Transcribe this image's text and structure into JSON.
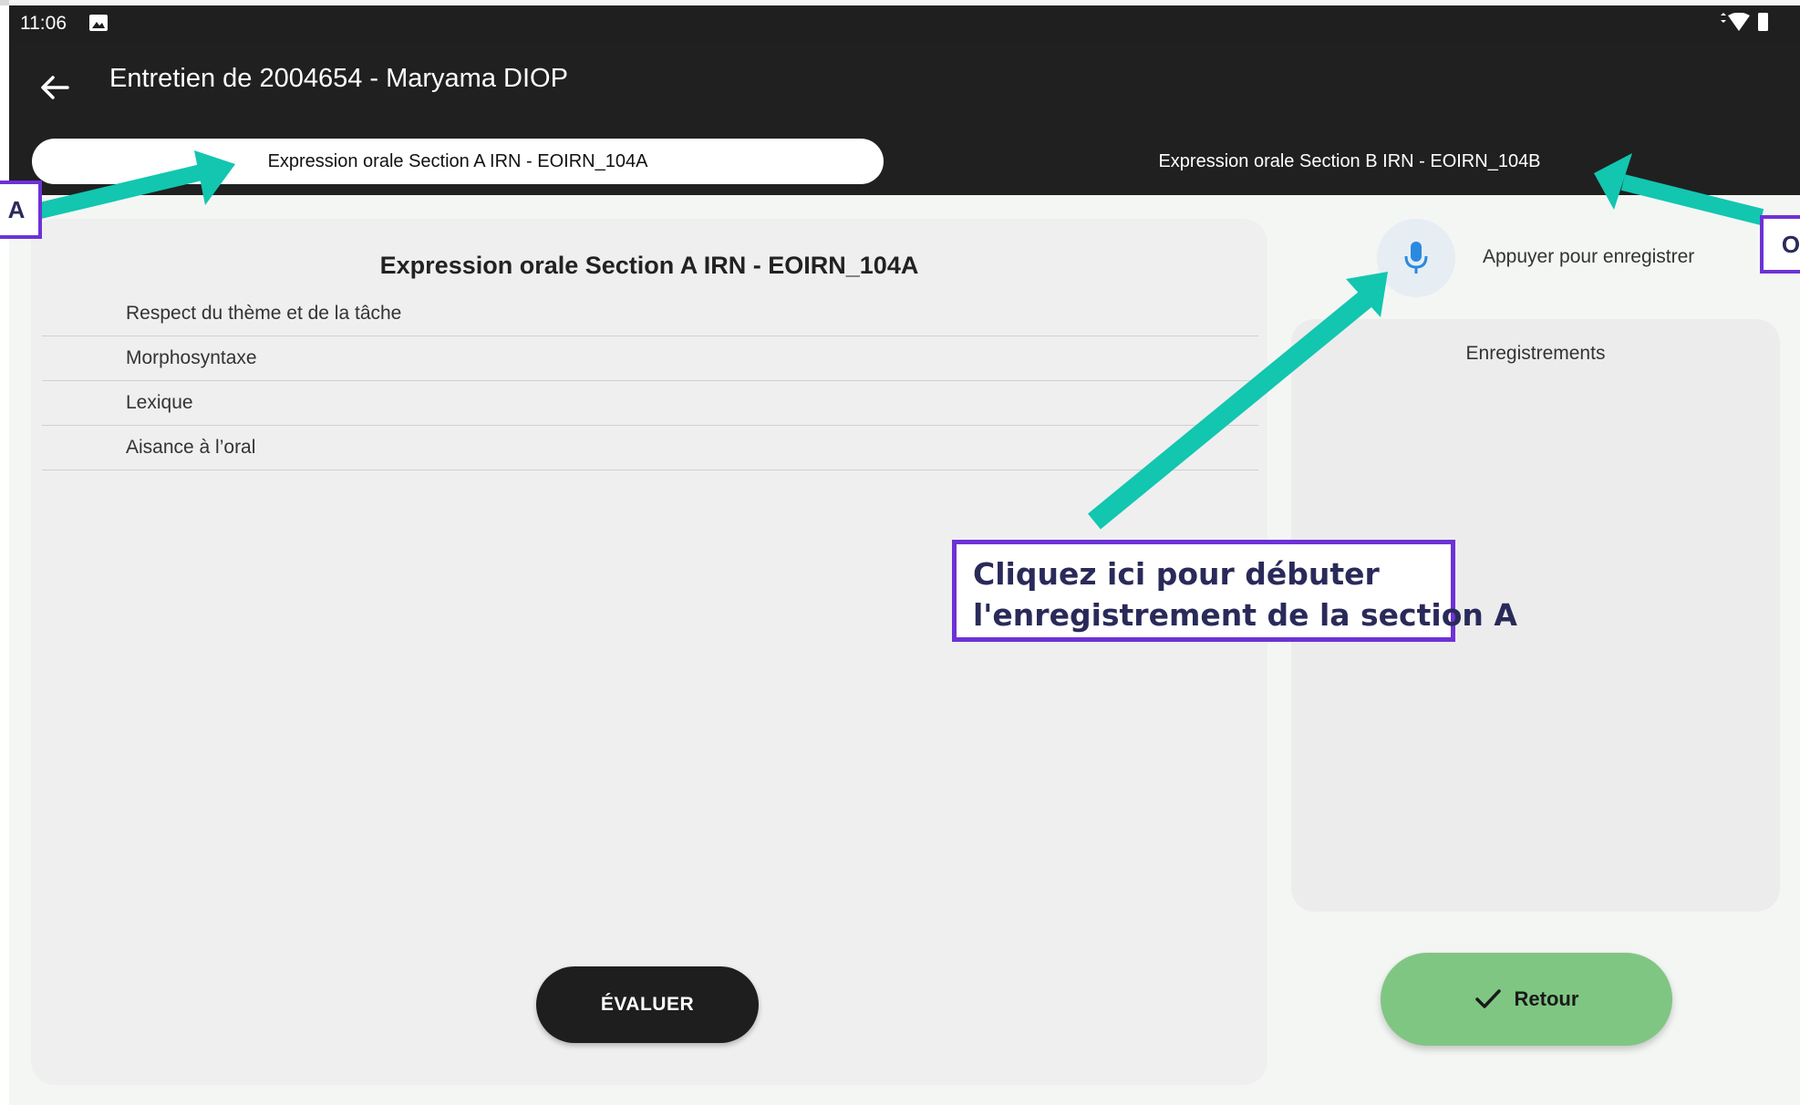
{
  "status_bar": {
    "time": "11:06",
    "left_icon": "image-icon",
    "right_icons": [
      "data-arrows-icon",
      "wifi-icon",
      "battery-icon"
    ]
  },
  "app_bar": {
    "back_icon": "arrow-back-icon",
    "title": "Entretien de 2004654 - Maryama DIOP"
  },
  "tabs": [
    {
      "label": "Expression orale Section A IRN - EOIRN_104A",
      "selected": true
    },
    {
      "label": "Expression orale Section B IRN - EOIRN_104B",
      "selected": false
    }
  ],
  "section_card": {
    "title": "Expression orale Section A IRN - EOIRN_104A",
    "criteria": [
      "Respect du thème et de la tâche",
      "Morphosyntaxe",
      "Lexique",
      "Aisance à l’oral"
    ],
    "evaluate_label": "ÉVALUER"
  },
  "recorder": {
    "mic_icon": "microphone-icon",
    "hint": "Appuyer pour enregistrer",
    "recordings_title": "Enregistrements"
  },
  "retour": {
    "icon": "check-icon",
    "label": "Retour"
  },
  "annotations": {
    "marker_left": "A",
    "marker_right": "O",
    "callout_line1": "Cliquez ici pour débuter",
    "callout_line2": "l'enregistrement de la section A"
  },
  "colors": {
    "appbar": "#202020",
    "accent_arrow": "#12c6b0",
    "callout_border": "#6d32d6",
    "retour_button": "#80c683",
    "mic_blue": "#2a8ae0"
  }
}
